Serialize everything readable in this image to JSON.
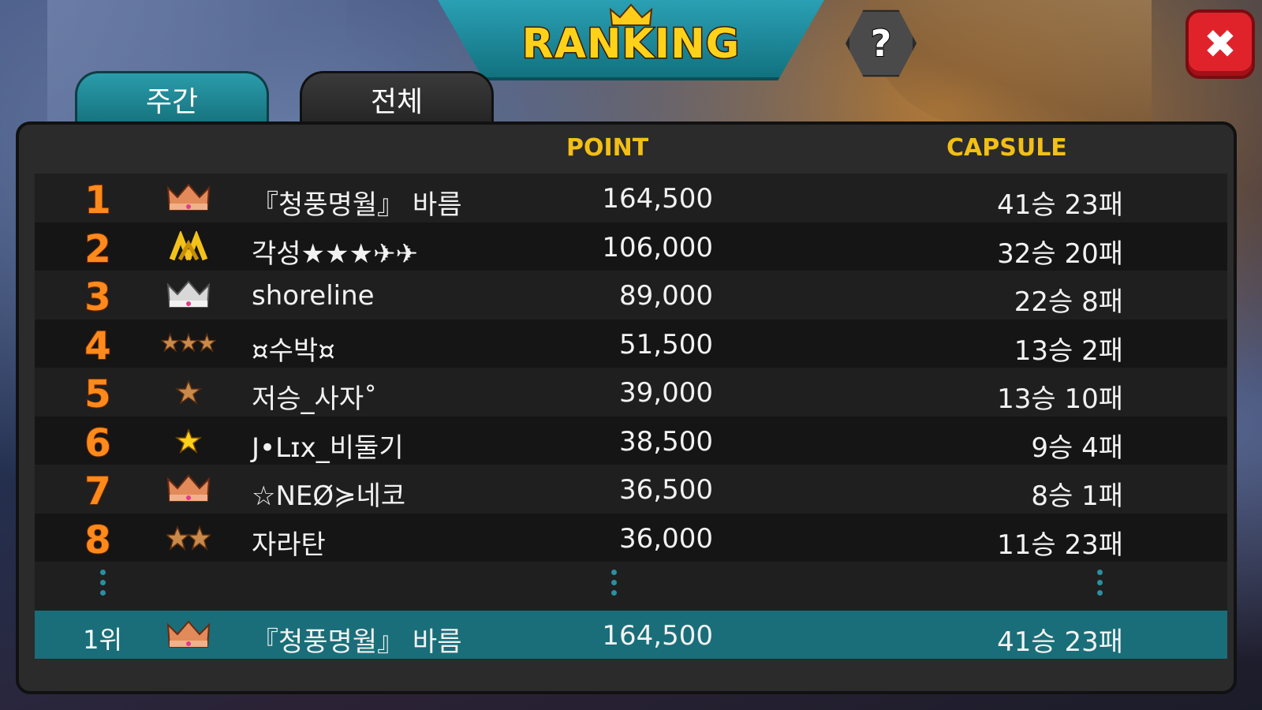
{
  "header": {
    "title": "RANKING",
    "help_label": "?",
    "close_label": "✖"
  },
  "tabs": [
    {
      "label": "주간",
      "active": true
    },
    {
      "label": "전체",
      "active": false
    }
  ],
  "columns": {
    "point": "POINT",
    "capsule": "CAPSULE"
  },
  "rows": [
    {
      "rank": "1",
      "badge": "crown-bronze-icon",
      "name": "『청풍명월』 바름",
      "point": "164,500",
      "record": "41승 23패"
    },
    {
      "rank": "2",
      "badge": "chevron-gold-icon",
      "name": "각성★★★✈✈",
      "point": "106,000",
      "record": "32승 20패"
    },
    {
      "rank": "3",
      "badge": "crown-silver-icon",
      "name": "shoreline",
      "point": "89,000",
      "record": "22승 8패"
    },
    {
      "rank": "4",
      "badge": "three-stars-bronze-icon",
      "name": "¤수박¤",
      "point": "51,500",
      "record": "13승 2패"
    },
    {
      "rank": "5",
      "badge": "star-bronze-icon",
      "name": "저승_사자˚",
      "point": "39,000",
      "record": "13승 10패"
    },
    {
      "rank": "6",
      "badge": "star-gold-icon",
      "name": "J•Lɪx_비둘기",
      "point": "38,500",
      "record": "9승 4패"
    },
    {
      "rank": "7",
      "badge": "crown-bronze-icon",
      "name": "☆NEØ≽네코",
      "point": "36,500",
      "record": "8승 1패"
    },
    {
      "rank": "8",
      "badge": "two-stars-bronze-icon",
      "name": "자라탄",
      "point": "36,000",
      "record": "11승 23패"
    }
  ],
  "my_rank": {
    "rank": "1위",
    "badge": "crown-bronze-icon",
    "name": "『청풍명월』 바름",
    "point": "164,500",
    "record": "41승 23패"
  },
  "colors": {
    "accent_teal": "#196e79",
    "header_gold": "#f3bf16",
    "rank_orange": "#ff8a1c",
    "close_red": "#e0232b"
  }
}
